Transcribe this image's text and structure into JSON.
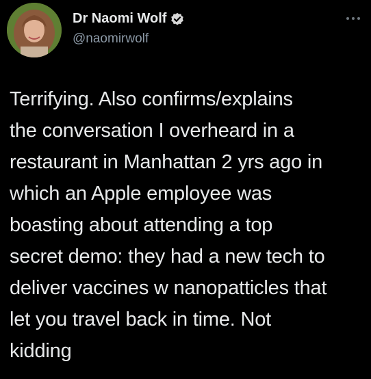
{
  "author": {
    "display_name": "Dr Naomi Wolf",
    "handle": "@naomirwolf",
    "verified": true
  },
  "menu": {
    "icon": "more-horizontal-icon"
  },
  "tweet": {
    "lines": [
      "Terrifying. Also confirms/explains",
      "the conversation I overheard in a",
      "restaurant in Manhattan 2 yrs ago in",
      "which an Apple employee was",
      "boasting about attending a top",
      "secret demo: they had a new tech to",
      "deliver vaccines w nanopatticles that",
      "let you travel back in time. Not",
      "kidding"
    ]
  },
  "colors": {
    "background": "#000000",
    "text": "#e7e9ea",
    "secondary": "#8b98a5",
    "verified_badge": "#d7d7d7"
  }
}
